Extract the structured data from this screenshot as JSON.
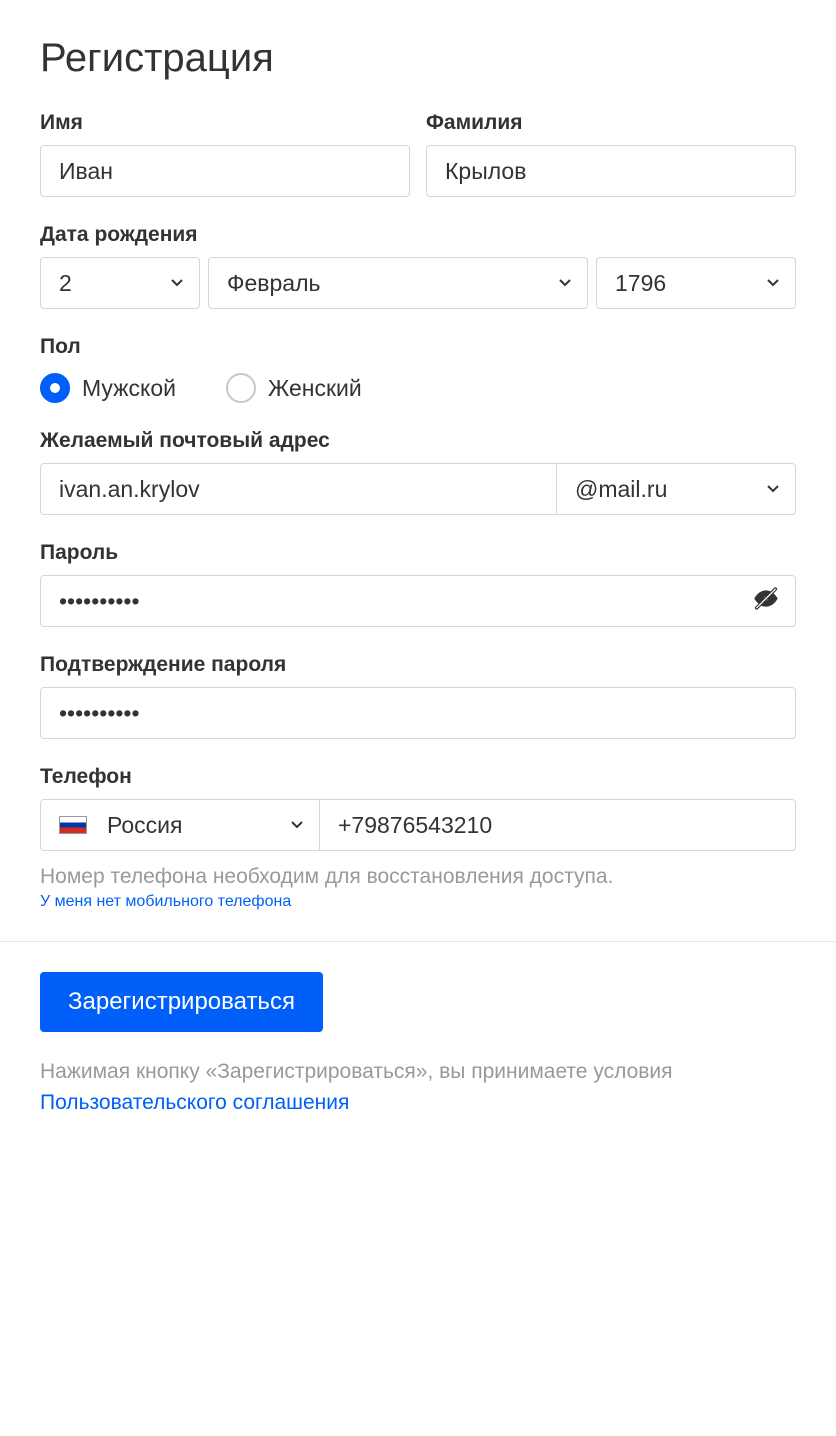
{
  "title": "Регистрация",
  "name": {
    "first_label": "Имя",
    "first_value": "Иван",
    "last_label": "Фамилия",
    "last_value": "Крылов"
  },
  "dob": {
    "label": "Дата рождения",
    "day": "2",
    "month": "Февраль",
    "year": "1796"
  },
  "gender": {
    "label": "Пол",
    "male": "Мужской",
    "female": "Женский"
  },
  "email": {
    "label": "Желаемый почтовый адрес",
    "value": "ivan.an.krylov",
    "domain": "@mail.ru"
  },
  "password": {
    "label": "Пароль",
    "value": "••••••••••"
  },
  "password_confirm": {
    "label": "Подтверждение пароля",
    "value": "••••••••••"
  },
  "phone": {
    "label": "Телефон",
    "country": "Россия",
    "number": "+79876543210",
    "hint": "Номер телефона необходим для восстановления доступа.",
    "no_phone_link": "У меня нет мобильного телефона"
  },
  "submit": "Зарегистрироваться",
  "agreement": {
    "prefix": "Нажимая кнопку «Зарегистрироваться», вы принимаете условия ",
    "link": "Пользовательского соглашения"
  }
}
